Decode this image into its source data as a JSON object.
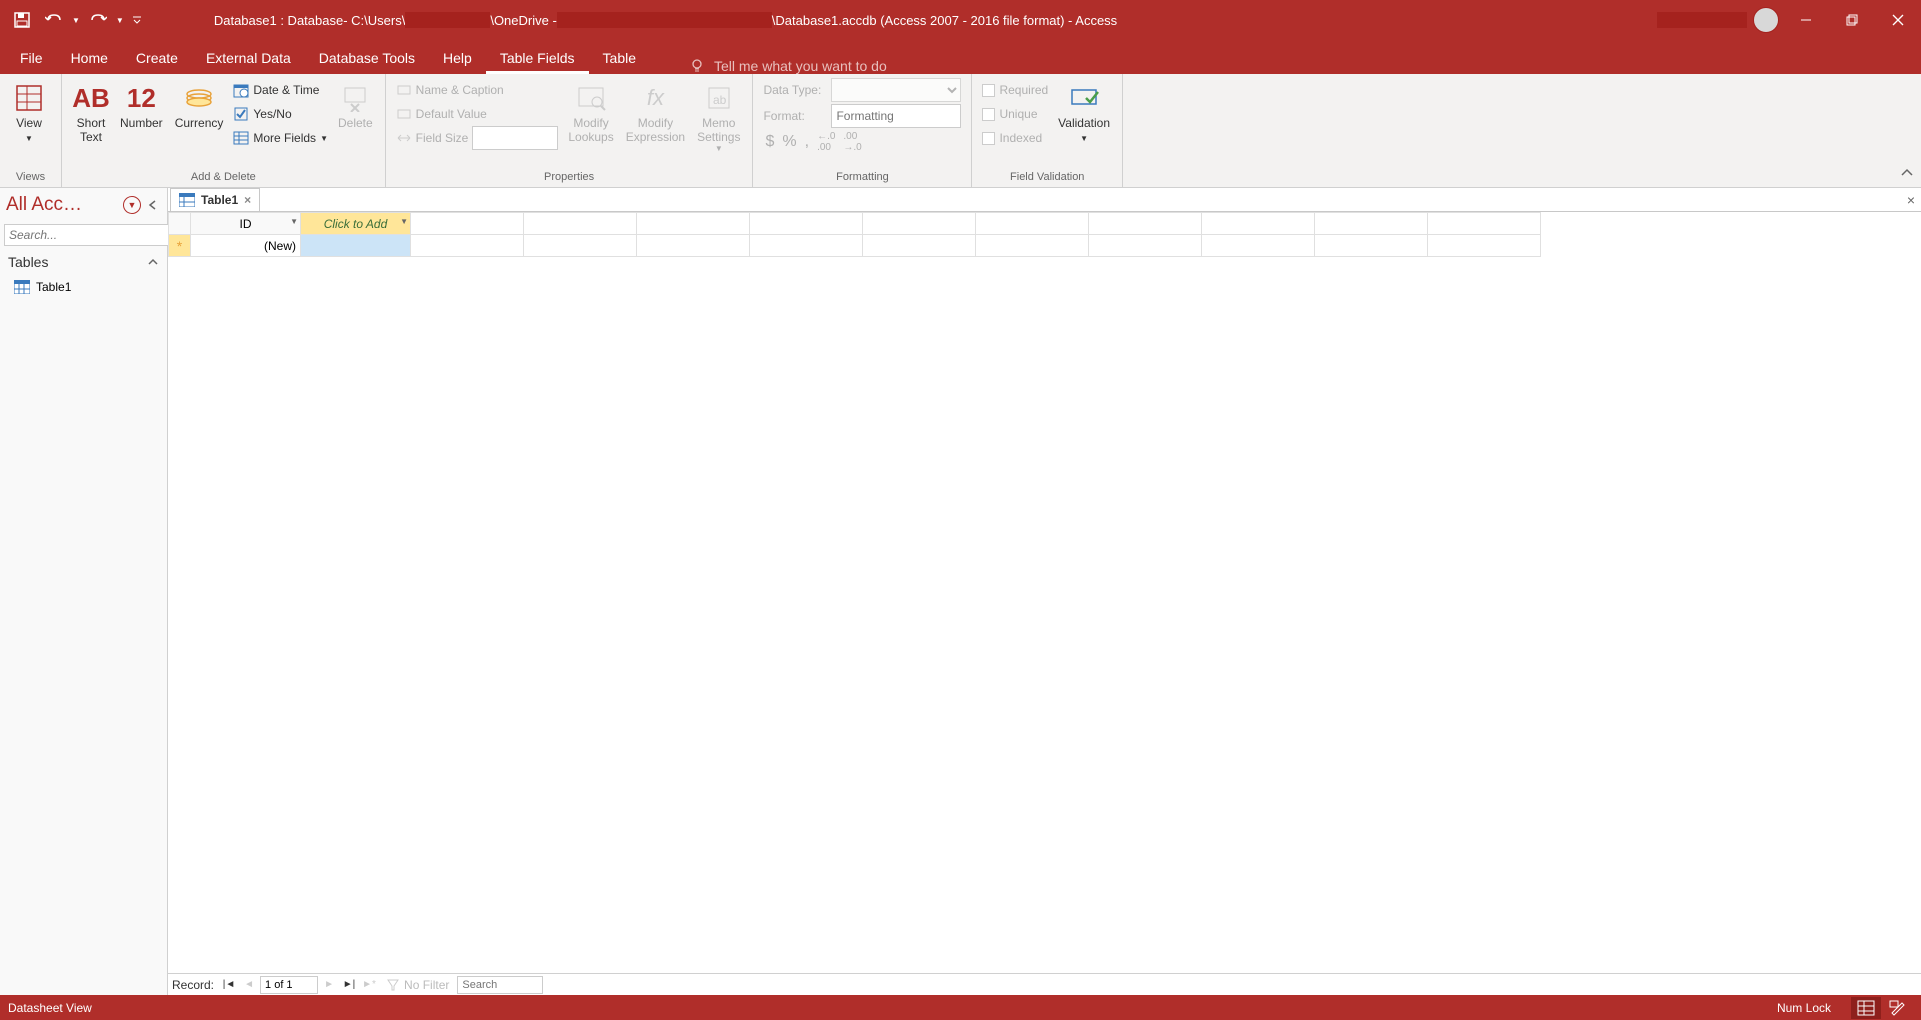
{
  "titlebar": {
    "path_pre": "Database1 : Database- C:\\Users\\",
    "path_mid": "\\OneDrive - ",
    "path_post": "\\Database1.accdb (Access 2007 - 2016 file format)  -  Access"
  },
  "ribbon": {
    "tabs": [
      "File",
      "Home",
      "Create",
      "External Data",
      "Database Tools",
      "Help",
      "Table Fields",
      "Table"
    ],
    "active_tab_index": 6,
    "tellme_placeholder": "Tell me what you want to do",
    "groups": {
      "views": {
        "label": "Views",
        "view_btn": "View"
      },
      "add_delete": {
        "label": "Add & Delete",
        "short_text": "Short\nText",
        "number": "Number",
        "currency": "Currency",
        "date_time": "Date & Time",
        "yes_no": "Yes/No",
        "more_fields": "More Fields",
        "delete": "Delete"
      },
      "properties": {
        "label": "Properties",
        "name_caption": "Name & Caption",
        "default_value": "Default Value",
        "field_size": "Field Size",
        "modify_lookups": "Modify\nLookups",
        "modify_expression": "Modify\nExpression",
        "memo_settings": "Memo\nSettings"
      },
      "formatting": {
        "label": "Formatting",
        "data_type": "Data Type:",
        "format": "Format:",
        "format_placeholder": "Formatting"
      },
      "validation": {
        "label": "Field Validation",
        "required": "Required",
        "unique": "Unique",
        "indexed": "Indexed",
        "validation_btn": "Validation"
      }
    }
  },
  "nav": {
    "title": "All Acc…",
    "search_placeholder": "Search...",
    "section": "Tables",
    "items": [
      "Table1"
    ]
  },
  "sheet": {
    "tab_name": "Table1",
    "columns": {
      "id": "ID",
      "click_to_add": "Click to Add"
    },
    "new_row": "(New)"
  },
  "recnav": {
    "label": "Record:",
    "position": "1 of 1",
    "no_filter": "No Filter",
    "search_placeholder": "Search"
  },
  "status": {
    "view": "Datasheet View",
    "numlock": "Num Lock"
  }
}
